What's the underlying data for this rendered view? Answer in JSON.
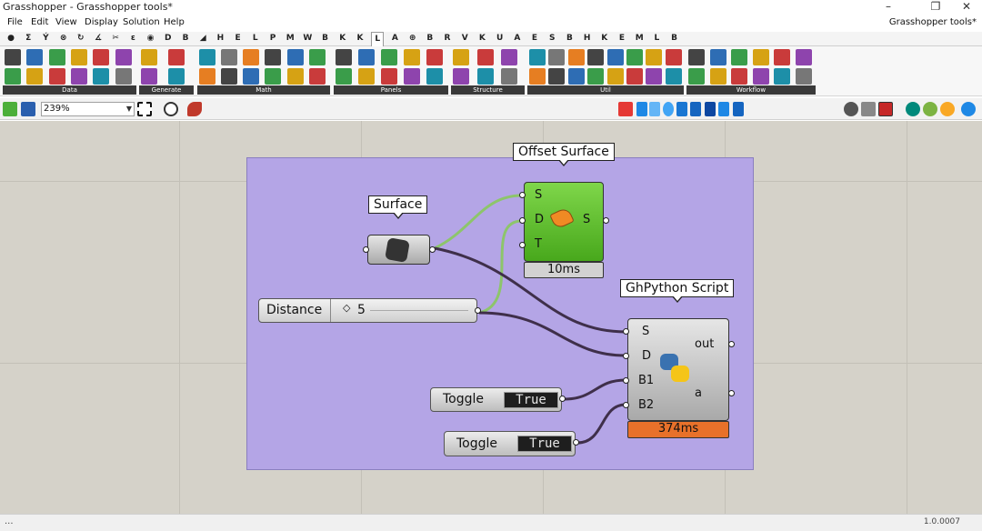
{
  "window": {
    "title": "Grasshopper - Grasshopper tools*",
    "minimize_glyph": "–",
    "restore_glyph": "❐",
    "close_glyph": "✕"
  },
  "menu": {
    "items": [
      "File",
      "Edit",
      "View",
      "Display",
      "Solution",
      "Help"
    ],
    "right_title": "Grasshopper tools*"
  },
  "tabs": {
    "items": [
      "●",
      "Σ",
      "Ý",
      "⊗",
      "↻",
      "∡",
      "✂",
      "ε",
      "◉",
      "D",
      "B",
      "◢",
      "H",
      "E",
      "L",
      "P",
      "M",
      "W",
      "B",
      "K",
      "K",
      "L",
      "A",
      "⊕",
      "B",
      "R",
      "V",
      "K",
      "U",
      "A",
      "E",
      "S",
      "B",
      "H",
      "K",
      "E",
      "M",
      "L",
      "B"
    ],
    "active_index": 21
  },
  "ribbon": {
    "groups": [
      {
        "label": "Data"
      },
      {
        "label": "Generate"
      },
      {
        "label": "Math"
      },
      {
        "label": "Panels"
      },
      {
        "label": "Structure"
      },
      {
        "label": "Util"
      },
      {
        "label": "Workflow"
      }
    ]
  },
  "toolbar": {
    "zoom": "239%"
  },
  "canvas": {
    "components": {
      "surface": {
        "label": "Surface"
      },
      "offset_surface": {
        "label": "Offset Surface",
        "inputs": [
          "S",
          "D",
          "T"
        ],
        "output": "S",
        "time": "10ms"
      },
      "distance": {
        "label": "Distance",
        "value": "5"
      },
      "ghpython": {
        "label": "GhPython Script",
        "inputs": [
          "S",
          "D",
          "B1",
          "B2"
        ],
        "outputs": [
          "out",
          "a"
        ],
        "time": "374ms"
      },
      "toggle1": {
        "label": "Toggle",
        "value": "True"
      },
      "toggle2": {
        "label": "Toggle",
        "value": "True"
      }
    }
  },
  "status": {
    "dots": "...",
    "version": "1.0.0007"
  },
  "colors": {
    "canvas": "#d5d2c9",
    "group": "#b4a5e6",
    "component_green": "#5cbf2a",
    "time_orange": "#e8712a",
    "wire_dark": "#3f2f4a",
    "wire_green": "#8dc56b"
  }
}
